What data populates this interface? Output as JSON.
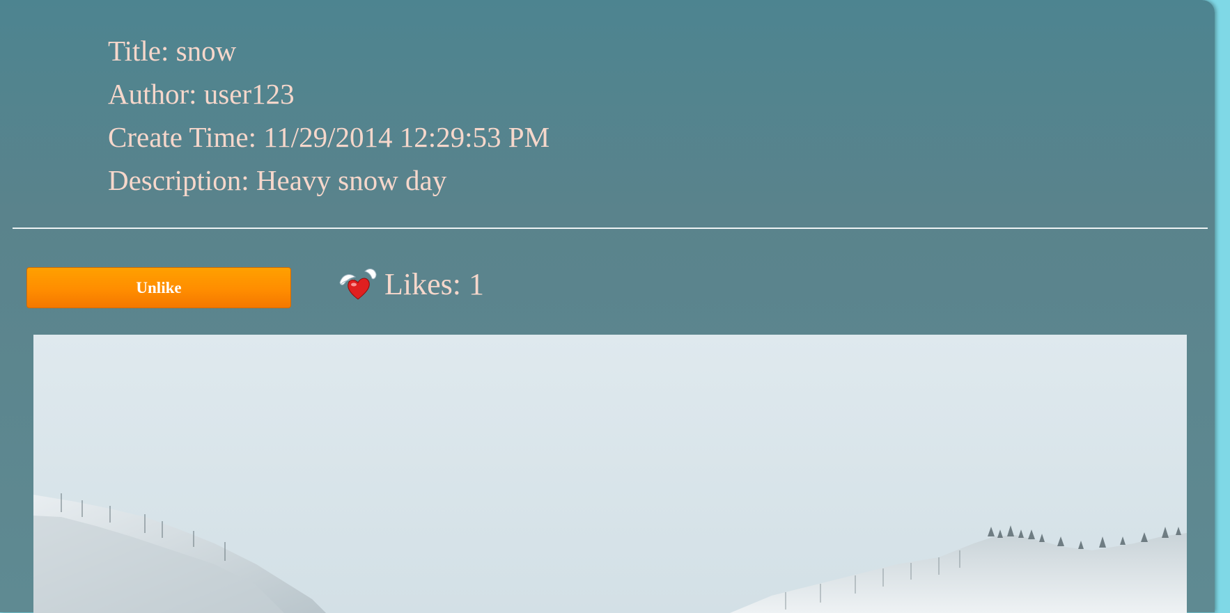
{
  "post": {
    "title_line": "Title: snow",
    "author_line": "Author: user123",
    "create_time_line": "Create Time: 11/29/2014 12:29:53 PM",
    "description_line": "Description: Heavy snow day"
  },
  "actions": {
    "unlike_label": "Unlike",
    "likes_label": "Likes: 1"
  },
  "icons": {
    "likes_icon": "winged-heart-icon"
  },
  "colors": {
    "panel": "#5a838c",
    "text": "#f6d7cb",
    "button": "#ff8d00",
    "page_background": "#7fd8e6"
  }
}
